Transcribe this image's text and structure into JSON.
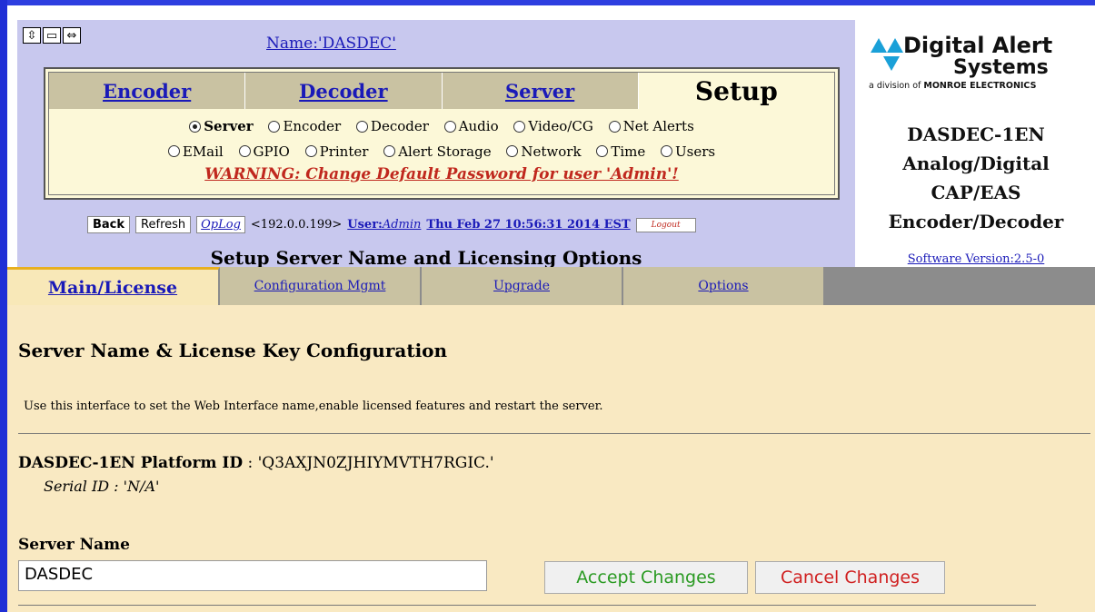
{
  "header": {
    "name_link": "Name:'DASDEC'",
    "icons": [
      "fullscreen-icon",
      "frame-icon",
      "resize-icon"
    ],
    "main_tabs": [
      {
        "label": "Encoder",
        "active": false
      },
      {
        "label": "Decoder",
        "active": false
      },
      {
        "label": "Server",
        "active": false
      },
      {
        "label": "Setup",
        "active": true
      }
    ],
    "radio_row1": [
      {
        "label": "Server",
        "selected": true
      },
      {
        "label": "Encoder",
        "selected": false
      },
      {
        "label": "Decoder",
        "selected": false
      },
      {
        "label": "Audio",
        "selected": false
      },
      {
        "label": "Video/CG",
        "selected": false
      },
      {
        "label": "Net Alerts",
        "selected": false
      }
    ],
    "radio_row2": [
      {
        "label": "EMail",
        "selected": false
      },
      {
        "label": "GPIO",
        "selected": false
      },
      {
        "label": "Printer",
        "selected": false
      },
      {
        "label": "Alert Storage",
        "selected": false
      },
      {
        "label": "Network",
        "selected": false
      },
      {
        "label": "Time",
        "selected": false
      },
      {
        "label": "Users",
        "selected": false
      }
    ],
    "warning": "WARNING: Change Default Password for user 'Admin'!",
    "nav": {
      "back": "Back",
      "refresh": "Refresh",
      "oplog": "OpLog",
      "ip": "<192.0.0.199>",
      "user_prefix": "User:",
      "user_name": "Admin",
      "datetime": "Thu Feb 27 10:56:31 2014 EST",
      "logout": "Logout"
    },
    "page_heading": "Setup Server Name and Licensing Options"
  },
  "brand": {
    "logo_line1": "Digital Alert",
    "logo_line2": "Systems",
    "logo_line3_prefix": "a division of ",
    "logo_line3_bold": "MONROE ELECTRONICS",
    "product_lines": [
      "DASDEC-1EN",
      "Analog/Digital",
      "CAP/EAS",
      "Encoder/Decoder"
    ],
    "software_version": "Software Version:2.5-0",
    "accent_color": "#1aa0d8"
  },
  "sub_tabs": [
    {
      "label": "Main/License",
      "active": true
    },
    {
      "label": "Configuration Mgmt",
      "active": false
    },
    {
      "label": "Upgrade",
      "active": false
    },
    {
      "label": "Options",
      "active": false
    }
  ],
  "content": {
    "section_title": "Server Name & License Key Configuration",
    "description": "Use this interface to set the Web Interface name,enable licensed features and restart the server.",
    "platform_label": "DASDEC-1EN Platform ID",
    "platform_value": " : 'Q3AXJN0ZJHIYMVTH7RGIC.'",
    "serial": "Serial ID : 'N/A'",
    "server_name_label": "Server Name",
    "server_name_value": "DASDEC",
    "accept_button": "Accept Changes",
    "cancel_button": "Cancel Changes"
  }
}
